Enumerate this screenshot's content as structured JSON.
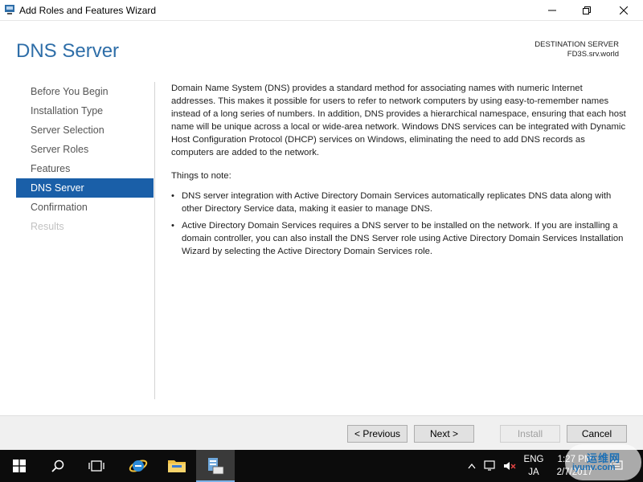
{
  "window": {
    "title": "Add Roles and Features Wizard"
  },
  "header": {
    "page_title": "DNS Server",
    "destination_label": "DESTINATION SERVER",
    "destination_server": "FD3S.srv.world"
  },
  "nav": {
    "items": [
      {
        "label": "Before You Begin",
        "state": "normal"
      },
      {
        "label": "Installation Type",
        "state": "normal"
      },
      {
        "label": "Server Selection",
        "state": "normal"
      },
      {
        "label": "Server Roles",
        "state": "normal"
      },
      {
        "label": "Features",
        "state": "normal"
      },
      {
        "label": "DNS Server",
        "state": "active"
      },
      {
        "label": "Confirmation",
        "state": "normal"
      },
      {
        "label": "Results",
        "state": "disabled"
      }
    ]
  },
  "content": {
    "description": "Domain Name System (DNS) provides a standard method for associating names with numeric Internet addresses. This makes it possible for users to refer to network computers by using easy-to-remember names instead of a long series of numbers. In addition, DNS provides a hierarchical namespace, ensuring that each host name will be unique across a local or wide-area network. Windows DNS services can be integrated with Dynamic Host Configuration Protocol (DHCP) services on Windows, eliminating the need to add DNS records as computers are added to the network.",
    "things_to_note": "Things to note:",
    "bullets": [
      "DNS server integration with Active Directory Domain Services automatically replicates DNS data along with other Directory Service data, making it easier to manage DNS.",
      "Active Directory Domain Services requires a DNS server to be installed on the network. If you are installing a domain controller, you can also install the DNS Server role using Active Directory Domain Services Installation Wizard by selecting the Active Directory Domain Services role."
    ],
    "bullet_glyph": "•"
  },
  "footer": {
    "previous_label": "< Previous",
    "next_label": "Next >",
    "install_label": "Install",
    "cancel_label": "Cancel"
  },
  "taskbar": {
    "language_top": "ENG",
    "language_bottom": "JA",
    "time": "1:27 PM",
    "date": "2/7/2017",
    "watermark_text": "运维网",
    "watermark_url": "iyunv.com"
  },
  "colors": {
    "accent": "#1a5fa8",
    "title_blue": "#2e6ea8",
    "taskbar": "#0c0c0c"
  }
}
